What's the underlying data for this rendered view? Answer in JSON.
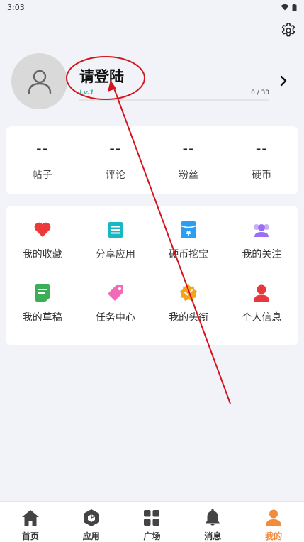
{
  "status_bar": {
    "time": "3:03"
  },
  "colors": {
    "accent": "#f28b3a",
    "level": "#2bbfa0",
    "annotation": "#d4141c",
    "favorite": "#ec3a3a",
    "share": "#17b8c4",
    "coin": "#2a9df4",
    "follow": "#9b6ef3",
    "draft": "#3cae55",
    "task": "#f26bb9",
    "headline": "#f4a417",
    "profile": "#e8383d"
  },
  "header": {
    "settings_icon": "gear-icon",
    "avatar_icon": "user-outline-icon",
    "title": "请登陆",
    "level": "Lv.1",
    "xp_text": "0 / 30",
    "xp_progress": 0,
    "chevron_icon": "chevron-right-icon"
  },
  "stats": [
    {
      "value": "--",
      "label": "帖子"
    },
    {
      "value": "--",
      "label": "评论"
    },
    {
      "value": "--",
      "label": "粉丝"
    },
    {
      "value": "--",
      "label": "硬币"
    }
  ],
  "grid": [
    {
      "label": "我的收藏",
      "icon": "heart-icon"
    },
    {
      "label": "分享应用",
      "icon": "list-square-icon"
    },
    {
      "label": "硬币挖宝",
      "icon": "yen-coin-icon"
    },
    {
      "label": "我的关注",
      "icon": "people-icon"
    },
    {
      "label": "我的草稿",
      "icon": "draft-icon"
    },
    {
      "label": "任务中心",
      "icon": "tag-icon"
    },
    {
      "label": "我的头衔",
      "icon": "badge-icon"
    },
    {
      "label": "个人信息",
      "icon": "person-icon"
    }
  ],
  "bottom_nav": [
    {
      "label": "首页",
      "icon": "home-icon",
      "active": false
    },
    {
      "label": "应用",
      "icon": "cube-icon",
      "active": false
    },
    {
      "label": "广场",
      "icon": "grid-icon",
      "active": false
    },
    {
      "label": "消息",
      "icon": "bell-icon",
      "active": false
    },
    {
      "label": "我的",
      "icon": "user-icon",
      "active": true
    }
  ]
}
